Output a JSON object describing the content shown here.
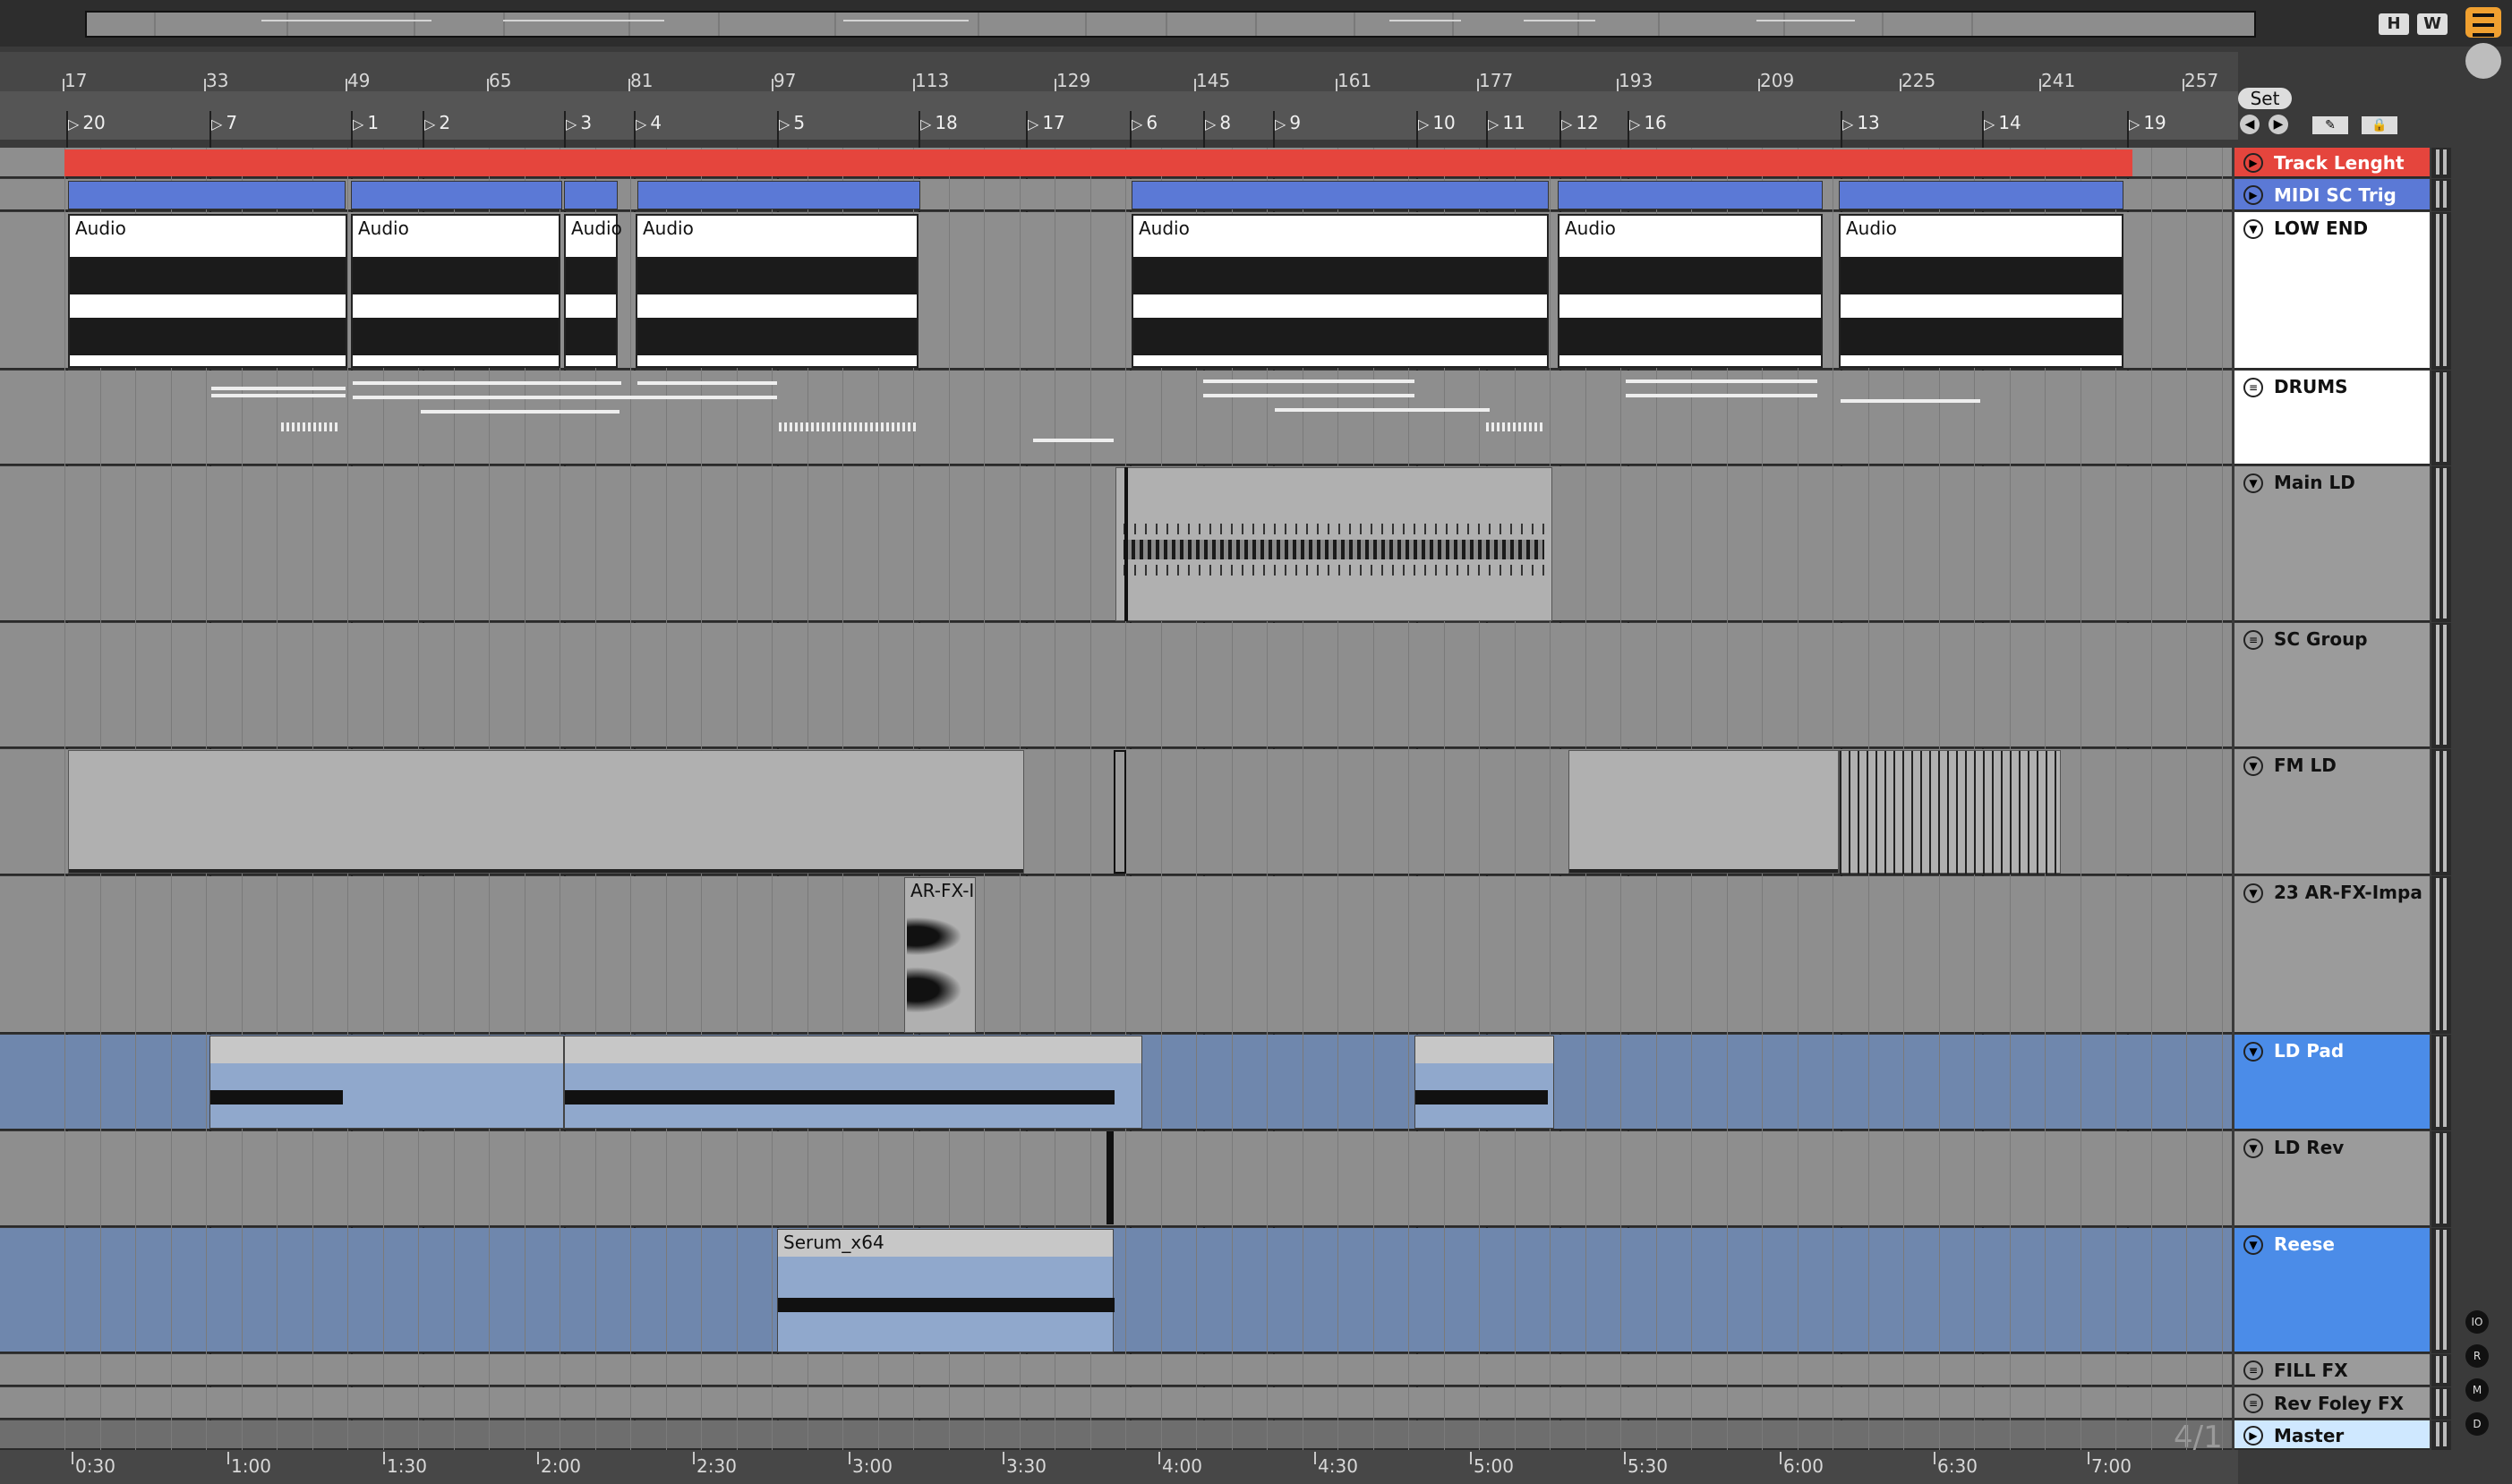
{
  "overview": {
    "buttons": [
      "H",
      "W"
    ]
  },
  "ruler": {
    "beats": [
      "17",
      "33",
      "49",
      "65",
      "81",
      "97",
      "113",
      "129",
      "145",
      "161",
      "177",
      "193",
      "209",
      "225",
      "241",
      "257"
    ],
    "times": [
      "0:30",
      "1:00",
      "1:30",
      "2:00",
      "2:30",
      "3:00",
      "3:30",
      "4:00",
      "4:30",
      "5:00",
      "5:30",
      "6:00",
      "6:30",
      "7:00"
    ],
    "time_signature": "4/1"
  },
  "set_button": "Set",
  "locators": [
    "20",
    "7",
    "1",
    "2",
    "3",
    "4",
    "5",
    "18",
    "17",
    "6",
    "8",
    "9",
    "10",
    "11",
    "12",
    "16",
    "13",
    "14",
    "19"
  ],
  "clip_labels": {
    "audio": "Audio",
    "arfx": "AR-FX-I",
    "serum": "Serum_x64"
  },
  "tracks": [
    {
      "name": "Track Lenght",
      "color": "#e5453d"
    },
    {
      "name": "MIDI SC Trig",
      "color": "#5b79d6"
    },
    {
      "name": "LOW END",
      "color": "#ffffff"
    },
    {
      "name": "DRUMS",
      "color": "#ffffff"
    },
    {
      "name": "Main LD",
      "color": "#9b9b9b"
    },
    {
      "name": "SC Group",
      "color": "#9b9b9b"
    },
    {
      "name": "FM LD",
      "color": "#9b9b9b"
    },
    {
      "name": "23 AR-FX-Impa",
      "color": "#9b9b9b"
    },
    {
      "name": "LD Pad",
      "color": "#4b8ce8"
    },
    {
      "name": "LD Rev",
      "color": "#9b9b9b"
    },
    {
      "name": "Reese",
      "color": "#4b8ce8"
    },
    {
      "name": "FILL FX",
      "color": "#9b9b9b"
    },
    {
      "name": "Rev Foley FX",
      "color": "#9b9b9b"
    },
    {
      "name": "Master",
      "color": "#cfe8ff"
    }
  ],
  "side_buttons": [
    "IO",
    "R",
    "M",
    "D"
  ]
}
